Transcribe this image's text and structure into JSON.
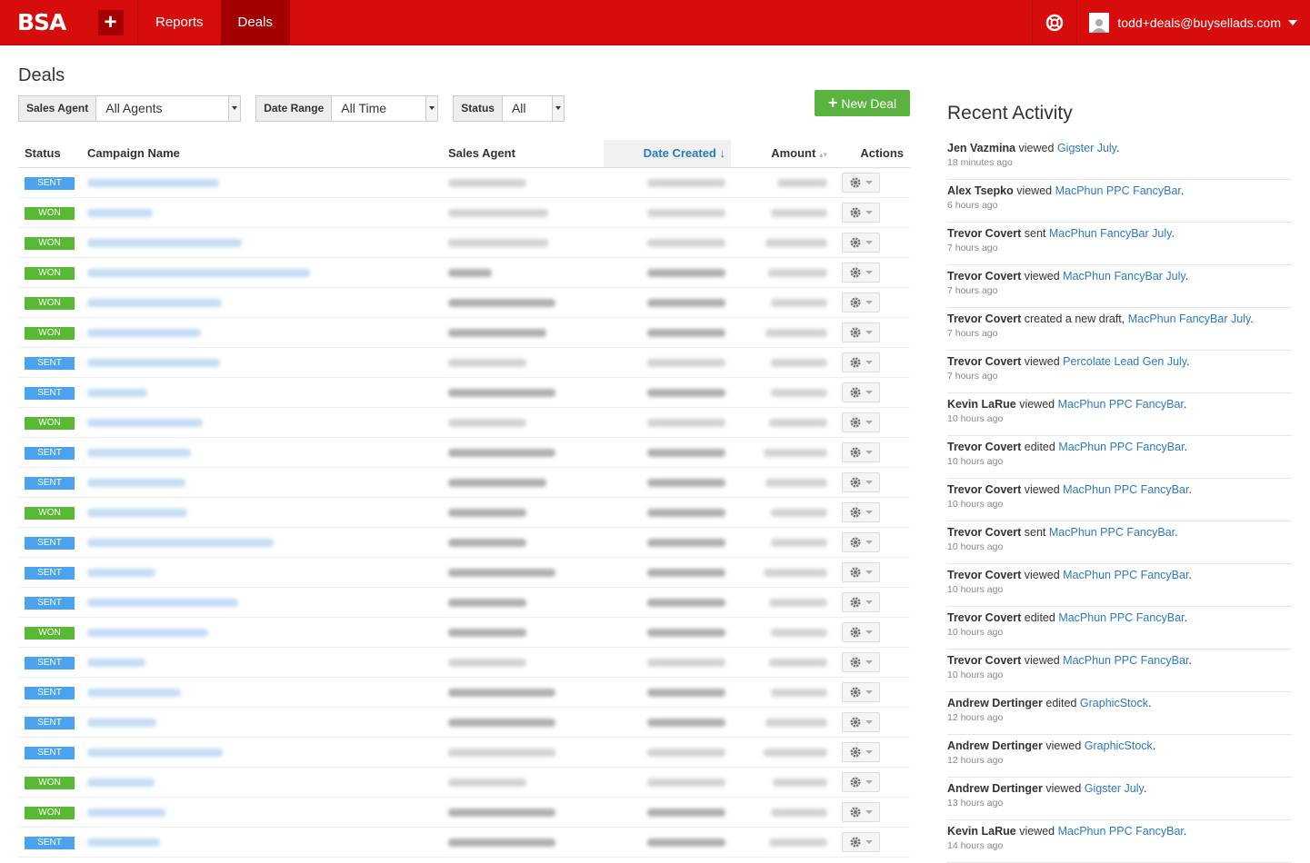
{
  "app": {
    "logo": "BSA",
    "plus": "+"
  },
  "nav": [
    {
      "label": "Reports",
      "active": false
    },
    {
      "label": "Deals",
      "active": true
    }
  ],
  "user": {
    "email": "todd+deals@buysellads.com"
  },
  "page": {
    "title": "Deals"
  },
  "filters": [
    {
      "label": "Sales Agent",
      "value": "All Agents"
    },
    {
      "label": "Date Range",
      "value": "All Time"
    },
    {
      "label": "Status",
      "value": "All"
    }
  ],
  "new_deal": {
    "label": "New Deal",
    "icon": "+"
  },
  "table": {
    "columns": {
      "status": "Status",
      "campaign": "Campaign Name",
      "agent": "Sales Agent",
      "date": "Date Created",
      "date_sort_icon": "↓",
      "amount": "Amount",
      "actions": "Actions"
    },
    "rows": [
      {
        "status": "SENT",
        "cls": "sent"
      },
      {
        "status": "WON",
        "cls": "won"
      },
      {
        "status": "WON",
        "cls": "won"
      },
      {
        "status": "WON",
        "cls": "won"
      },
      {
        "status": "WON",
        "cls": "won"
      },
      {
        "status": "WON",
        "cls": "won"
      },
      {
        "status": "SENT",
        "cls": "sent"
      },
      {
        "status": "SENT",
        "cls": "sent"
      },
      {
        "status": "WON",
        "cls": "won"
      },
      {
        "status": "SENT",
        "cls": "sent"
      },
      {
        "status": "SENT",
        "cls": "sent"
      },
      {
        "status": "WON",
        "cls": "won"
      },
      {
        "status": "SENT",
        "cls": "sent"
      },
      {
        "status": "SENT",
        "cls": "sent"
      },
      {
        "status": "SENT",
        "cls": "sent"
      },
      {
        "status": "WON",
        "cls": "won"
      },
      {
        "status": "SENT",
        "cls": "sent"
      },
      {
        "status": "SENT",
        "cls": "sent"
      },
      {
        "status": "SENT",
        "cls": "sent"
      },
      {
        "status": "SENT",
        "cls": "sent"
      },
      {
        "status": "WON",
        "cls": "won"
      },
      {
        "status": "WON",
        "cls": "won"
      },
      {
        "status": "SENT",
        "cls": "sent"
      }
    ]
  },
  "activity": {
    "title": "Recent Activity",
    "items": [
      {
        "who": "Jen Vazmina",
        "action": "viewed",
        "target": "Gigster July",
        "when": "18 minutes ago"
      },
      {
        "who": "Alex Tsepko",
        "action": "viewed",
        "target": "MacPhun PPC FancyBar",
        "when": "6 hours ago"
      },
      {
        "who": "Trevor Covert",
        "action": "sent",
        "target": "MacPhun FancyBar July",
        "when": "7 hours ago"
      },
      {
        "who": "Trevor Covert",
        "action": "viewed",
        "target": "MacPhun FancyBar July",
        "when": "7 hours ago"
      },
      {
        "who": "Trevor Covert",
        "action": "created a new draft,",
        "target": "MacPhun FancyBar July",
        "when": "7 hours ago"
      },
      {
        "who": "Trevor Covert",
        "action": "viewed",
        "target": "Percolate Lead Gen July",
        "when": "7 hours ago"
      },
      {
        "who": "Kevin LaRue",
        "action": "viewed",
        "target": "MacPhun PPC FancyBar",
        "when": "10 hours ago"
      },
      {
        "who": "Trevor Covert",
        "action": "edited",
        "target": "MacPhun PPC FancyBar",
        "when": "10 hours ago"
      },
      {
        "who": "Trevor Covert",
        "action": "viewed",
        "target": "MacPhun PPC FancyBar",
        "when": "10 hours ago"
      },
      {
        "who": "Trevor Covert",
        "action": "sent",
        "target": "MacPhun PPC FancyBar",
        "when": "10 hours ago"
      },
      {
        "who": "Trevor Covert",
        "action": "viewed",
        "target": "MacPhun PPC FancyBar",
        "when": "10 hours ago"
      },
      {
        "who": "Trevor Covert",
        "action": "edited",
        "target": "MacPhun PPC FancyBar",
        "when": "10 hours ago"
      },
      {
        "who": "Trevor Covert",
        "action": "viewed",
        "target": "MacPhun PPC FancyBar",
        "when": "10 hours ago"
      },
      {
        "who": "Andrew Dertinger",
        "action": "edited",
        "target": "GraphicStock",
        "when": "12 hours ago"
      },
      {
        "who": "Andrew Dertinger",
        "action": "viewed",
        "target": "GraphicStock",
        "when": "12 hours ago"
      },
      {
        "who": "Andrew Dertinger",
        "action": "viewed",
        "target": "Gigster July",
        "when": "13 hours ago"
      },
      {
        "who": "Kevin LaRue",
        "action": "viewed",
        "target": "MacPhun PPC FancyBar",
        "when": "14 hours ago"
      }
    ]
  },
  "colors": {
    "topbar": "#d70d0d",
    "active_nav": "#a30000",
    "sent": "#4ba3ef",
    "won": "#5ab934",
    "link": "#2a7ac0",
    "new_deal": "#5bb33f"
  }
}
